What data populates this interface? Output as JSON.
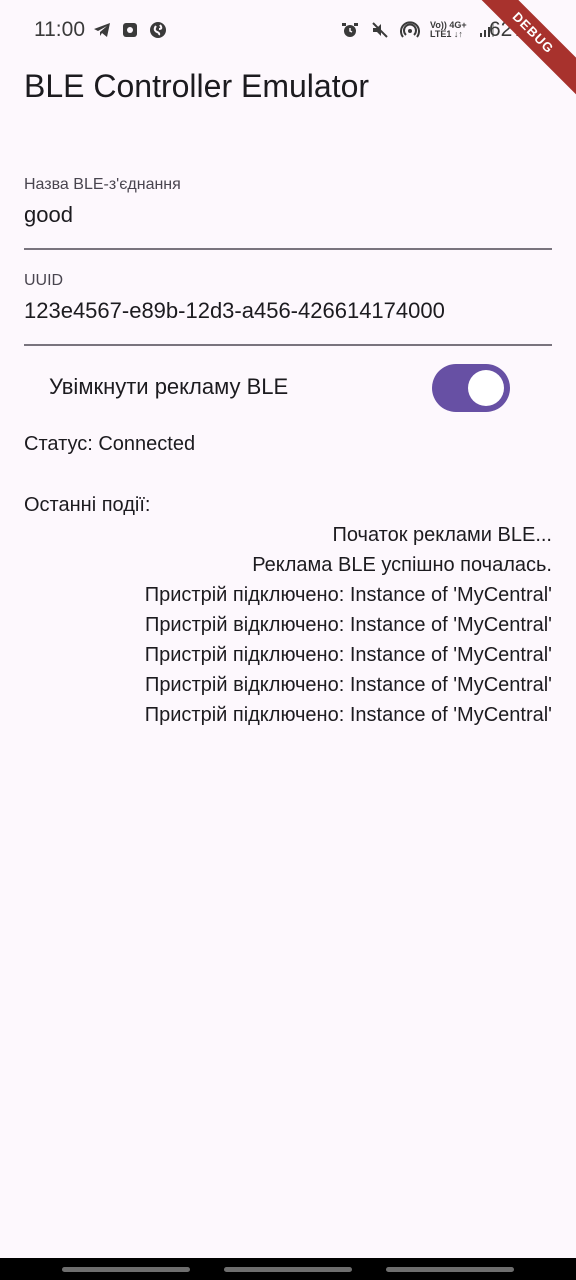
{
  "status_bar": {
    "time": "11:00",
    "battery": "62%",
    "net_line1": "Vo)) 4G+",
    "net_line2": "LTE1 ↓↑"
  },
  "debug_banner": "DEBUG",
  "app": {
    "title": "BLE Controller Emulator"
  },
  "form": {
    "name_label": "Назва BLE-з'єднання",
    "name_value": "good",
    "uuid_label": "UUID",
    "uuid_value": "123e4567-e89b-12d3-a456-426614174000"
  },
  "toggle": {
    "label": "Увімкнути рекламу BLE",
    "on": true,
    "accent": "#6750a4"
  },
  "status": "Статус: Connected",
  "events": {
    "title": "Останні події:",
    "items": [
      "Початок реклами BLE...",
      "Реклама BLE успішно почалась.",
      "Пристрій підключено: Instance of 'MyCentral'",
      "Пристрій відключено: Instance of 'MyCentral'",
      "Пристрій підключено: Instance of 'MyCentral'",
      "Пристрій відключено: Instance of 'MyCentral'",
      "Пристрій підключено: Instance of 'MyCentral'"
    ]
  }
}
